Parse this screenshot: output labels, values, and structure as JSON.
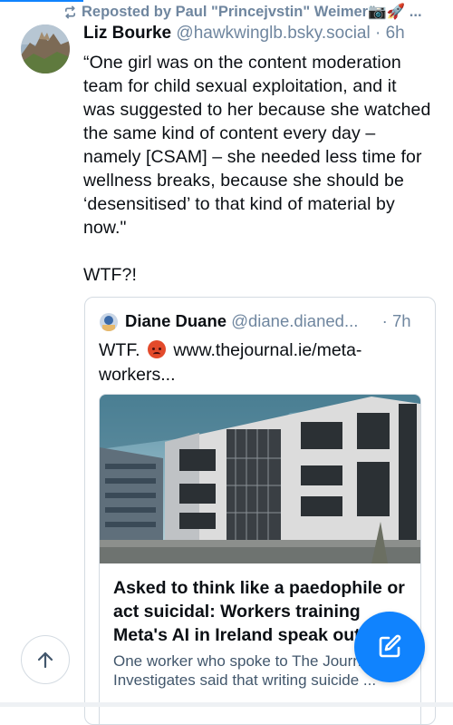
{
  "repost_banner": {
    "text": "Reposted by Paul \"Princejvstin\" Weimer📷🚀 ..."
  },
  "post": {
    "author_name": "Liz Bourke",
    "handle": "@hawkwinglb.bsky.social",
    "separator": "·",
    "time": "6h",
    "text": "“One girl was on the content moderation team for child sexual exploitation, and it was suggested to her because she watched the same kind of content every day – namely [CSAM] – she needed less time for wellness breaks, because she should be ‘desensitised’ to that kind of material by now.\"",
    "text2": "WTF?!"
  },
  "quote": {
    "author_name": "Diane Duane",
    "handle": "@diane.dianed...",
    "separator": "·",
    "time": "7h",
    "text_before_emoji": "WTF.",
    "text_after_emoji": "www.thejournal.ie/meta-workers...",
    "link_card": {
      "title": "Asked to think like a paedophile or act suicidal: Workers training Meta's AI in Ireland speak out",
      "description": "One worker who spoke to The Journal Investigates said that writing suicide ..."
    }
  },
  "icons": {
    "repost": "repost-icon",
    "scroll_top": "arrow-up-icon",
    "compose": "compose-icon",
    "emoji": "angry-face-emoji"
  },
  "colors": {
    "accent": "#1083fe",
    "muted": "#6f869f",
    "text": "#0b0f14",
    "border": "#d4dbe2"
  }
}
